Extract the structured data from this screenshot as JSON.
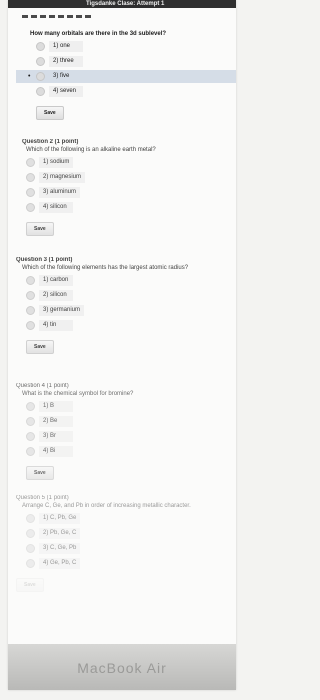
{
  "header": {
    "title": "Tigsdanke Clase: Attempt 1"
  },
  "questions": [
    {
      "title": "",
      "text": "How many orbitals are there in the 3d sublevel?",
      "options": [
        "1) one",
        "2) three",
        "3) five",
        "4) seven"
      ],
      "selected_index": 2,
      "save_label": "Save"
    },
    {
      "title": "Question 2 (1 point)",
      "text": "Which of the following is an alkaline earth metal?",
      "options": [
        "1) sodium",
        "2) magnesium",
        "3) aluminum",
        "4) silicon"
      ],
      "save_label": "Save"
    },
    {
      "title": "Question 3 (1 point)",
      "text": "Which of the following elements has the largest atomic radius?",
      "options": [
        "1) carbon",
        "2) silicon",
        "3) germanium",
        "4) tin"
      ],
      "save_label": "Save"
    },
    {
      "title": "Question 4 (1 point)",
      "text": "What is the chemical symbol for bromine?",
      "options": [
        "1) B",
        "2) Be",
        "3) Br",
        "4) Bi"
      ],
      "save_label": "Save"
    },
    {
      "title": "Question 5 (1 point)",
      "text": "Arrange C, Ge, and Pb in order of increasing metallic character.",
      "options": [
        "1) C, Pb, Ge",
        "2) Pb, Ge, C",
        "3) C, Ge, Pb",
        "4) Ge, Pb, C"
      ],
      "save_label": "Save"
    }
  ],
  "bezel": {
    "label": "MacBook Air"
  }
}
